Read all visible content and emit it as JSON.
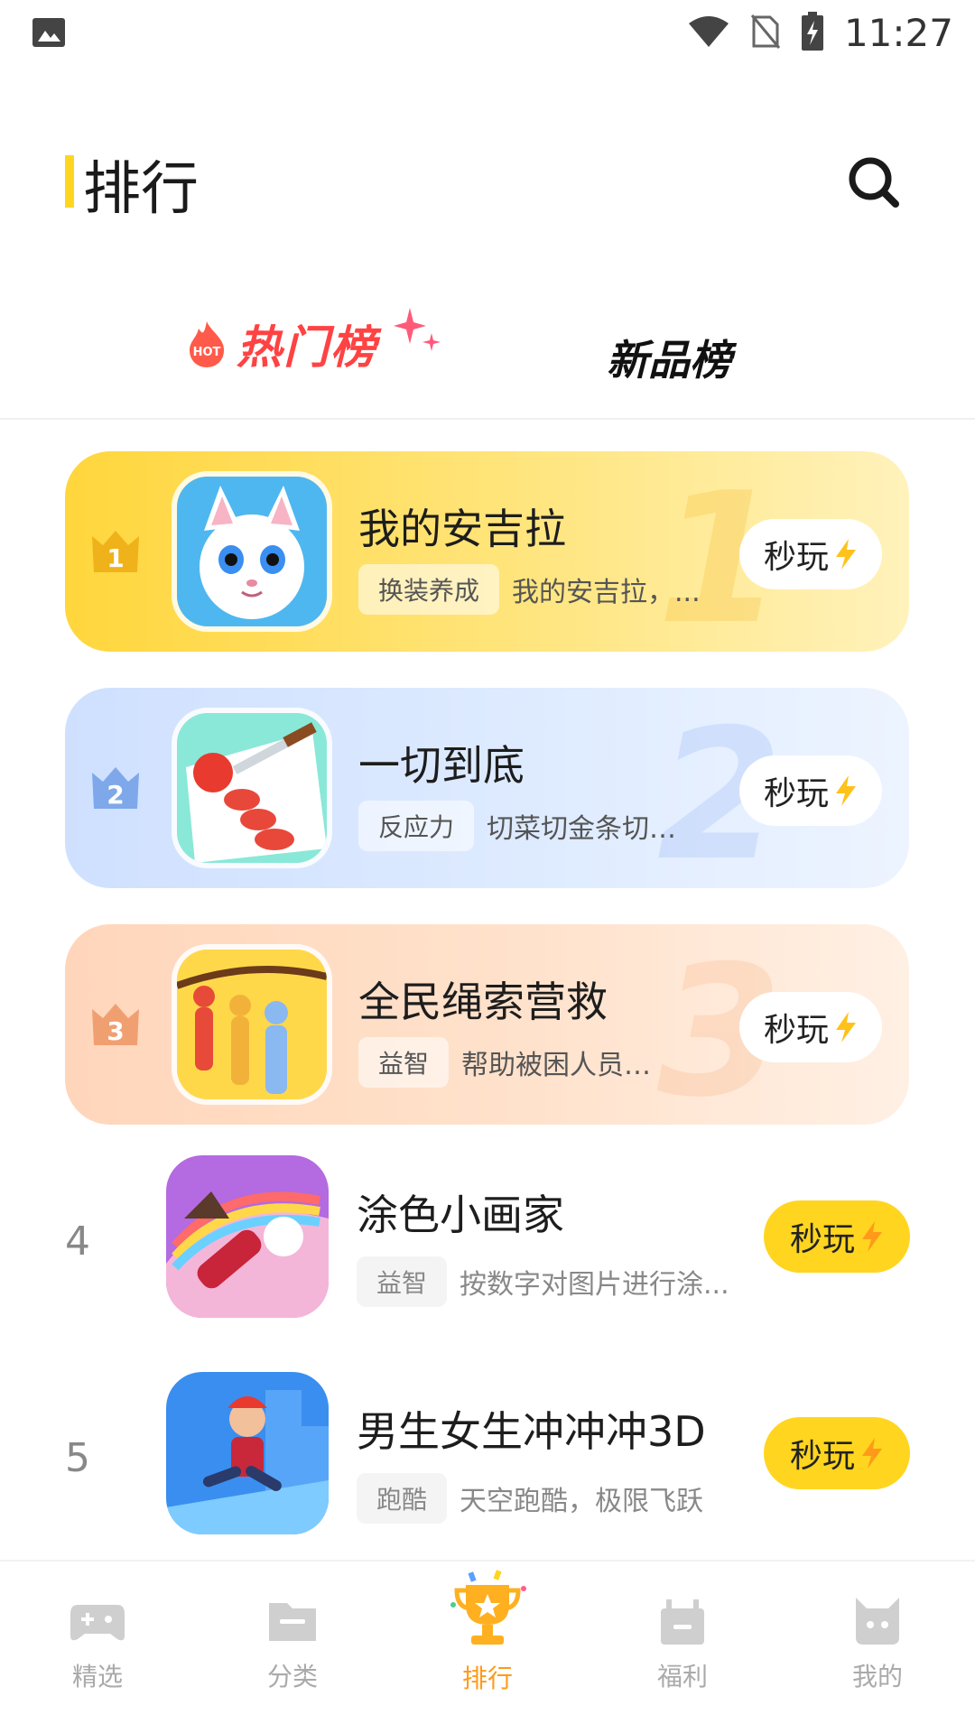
{
  "status_bar": {
    "time": "11:27",
    "icons": [
      "image-icon",
      "wifi-icon",
      "no-sim-icon",
      "battery-charging-icon"
    ]
  },
  "header": {
    "title": "排行",
    "search_icon": "search-icon"
  },
  "tabs": {
    "hot_label": "热门榜",
    "hot_badge": "HOT",
    "new_label": "新品榜"
  },
  "top_cards": [
    {
      "rank": "1",
      "big_rank": "1",
      "name": "我的安吉拉",
      "tag": "换装养成",
      "desc": "我的安吉拉，...",
      "play_label": "秒玩"
    },
    {
      "rank": "2",
      "big_rank": "2",
      "name": "一切到底",
      "tag": "反应力",
      "desc": "切菜切金条切水...",
      "play_label": "秒玩"
    },
    {
      "rank": "3",
      "big_rank": "3",
      "name": "全民绳索营救",
      "tag": "益智",
      "desc": "帮助被困人员达到...",
      "play_label": "秒玩"
    }
  ],
  "rows": [
    {
      "rank": "4",
      "name": "涂色小画家",
      "tag": "益智",
      "desc": "按数字对图片进行涂...",
      "play_label": "秒玩"
    },
    {
      "rank": "5",
      "name": "男生女生冲冲冲3D",
      "tag": "跑酷",
      "desc": "天空跑酷，极限飞跃",
      "play_label": "秒玩"
    }
  ],
  "bottom_nav": [
    {
      "label": "精选",
      "icon": "gamepad-icon"
    },
    {
      "label": "分类",
      "icon": "folder-icon"
    },
    {
      "label": "排行",
      "icon": "trophy-icon",
      "active": true
    },
    {
      "label": "福利",
      "icon": "gift-icon"
    },
    {
      "label": "我的",
      "icon": "profile-icon"
    }
  ],
  "colors": {
    "accent": "#ffd51f",
    "hot": "#ff4242",
    "active_nav": "#ff9a1a"
  }
}
